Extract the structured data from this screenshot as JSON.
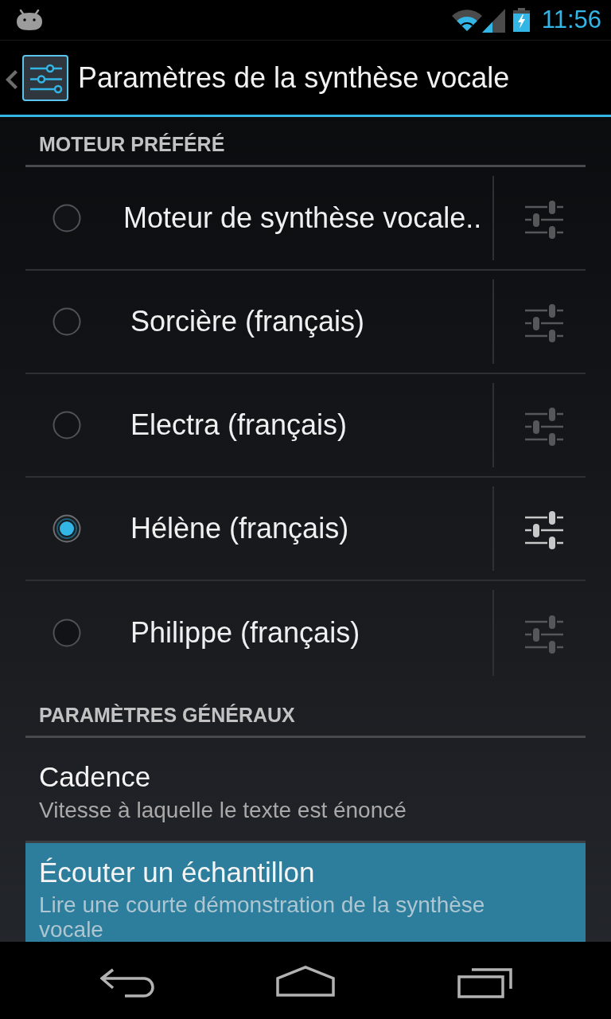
{
  "status_bar": {
    "time": "11:56"
  },
  "action_bar": {
    "title": "Paramètres de la synthèse vocale"
  },
  "sections": [
    {
      "kind": "engines",
      "header": "MOTEUR PRÉFÉRÉ",
      "engines": [
        {
          "label": "Moteur de synthèse vocale..",
          "selected": false
        },
        {
          "label": "Sorcière (français)",
          "selected": false
        },
        {
          "label": "Electra (français)",
          "selected": false
        },
        {
          "label": "Hélène (français)",
          "selected": true
        },
        {
          "label": "Philippe (français)",
          "selected": false
        }
      ]
    },
    {
      "kind": "preferences",
      "header": "PARAMÈTRES GÉNÉRAUX",
      "items": [
        {
          "title": "Cadence",
          "summary": "Vitesse à laquelle le texte est énoncé",
          "highlighted": false
        },
        {
          "title": "Écouter un échantillon",
          "summary": "Lire une courte démonstration de la synthèse vocale",
          "highlighted": true
        }
      ]
    }
  ]
}
